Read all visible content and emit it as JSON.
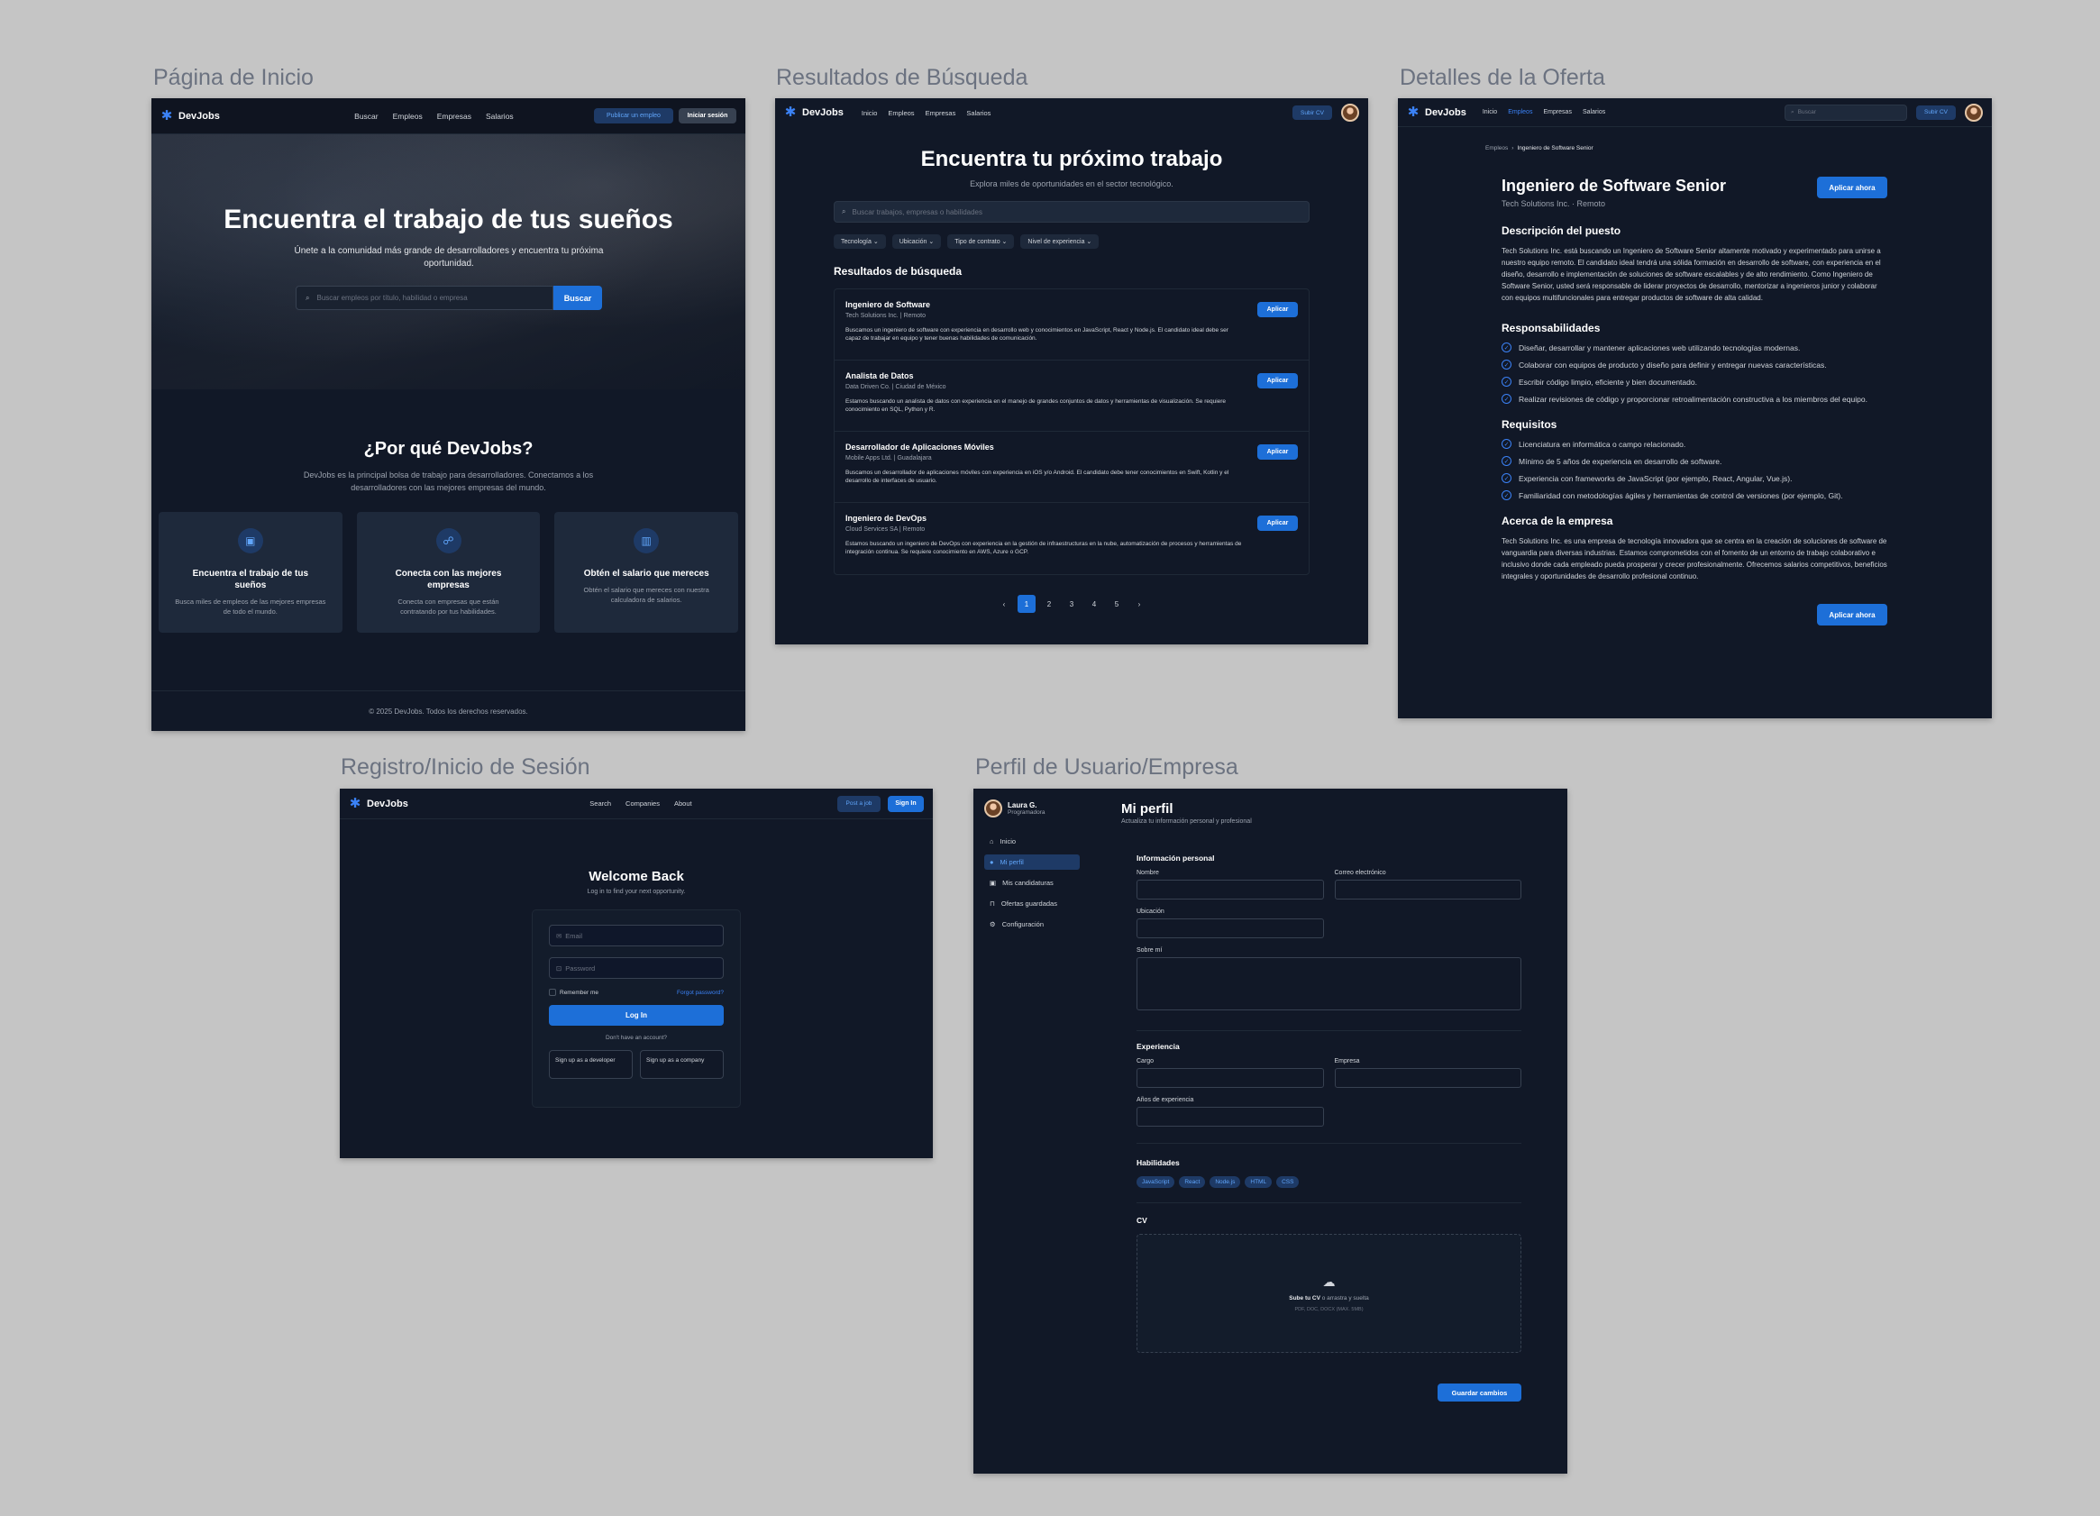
{
  "captions": {
    "home": "Página de Inicio",
    "search": "Resultados de Búsqueda",
    "detail": "Detalles de la Oferta",
    "login": "Registro/Inicio de Sesión",
    "profile": "Perfil de Usuario/Empresa"
  },
  "colors": {
    "background": "#111827",
    "accent": "#1d6fd8",
    "card": "#1e293b"
  },
  "home": {
    "brand": "DevJobs",
    "nav": [
      "Buscar",
      "Empleos",
      "Empresas",
      "Salarios"
    ],
    "post_job": "Publicar un empleo",
    "login": "Iniciar sesión",
    "hero_title": "Encuentra el trabajo de tus sueños",
    "hero_sub": "Únete a la comunidad más grande de desarrolladores y encuentra tu próxima oportunidad.",
    "search_placeholder": "Buscar empleos por título, habilidad o empresa",
    "search_btn": "Buscar",
    "why_title": "¿Por qué DevJobs?",
    "why_sub": "DevJobs es la principal bolsa de trabajo para desarrolladores. Conectamos a los desarrolladores con las mejores empresas del mundo.",
    "features": [
      {
        "icon": "briefcase-icon",
        "title": "Encuentra el trabajo de tus sueños",
        "text": "Busca miles de empleos de las mejores empresas de todo el mundo."
      },
      {
        "icon": "users-icon",
        "title": "Conecta con las mejores empresas",
        "text": "Conecta con empresas que están contratando por tus habilidades."
      },
      {
        "icon": "building-icon",
        "title": "Obtén el salario que mereces",
        "text": "Obtén el salario que mereces con nuestra calculadora de salarios."
      }
    ],
    "footer": "© 2025 DevJobs. Todos los derechos reservados."
  },
  "search": {
    "brand": "DevJobs",
    "nav": [
      "Inicio",
      "Empleos",
      "Empresas",
      "Salarios"
    ],
    "upload_cv": "Subir CV",
    "title": "Encuentra tu próximo trabajo",
    "subtitle": "Explora miles de oportunidades en el sector tecnológico.",
    "placeholder": "Buscar trabajos, empresas o habilidades",
    "filters": [
      "Tecnología",
      "Ubicación",
      "Tipo de contrato",
      "Nivel de experiencia"
    ],
    "results_title": "Resultados de búsqueda",
    "apply": "Aplicar",
    "jobs": [
      {
        "title": "Ingeniero de Software",
        "company": "Tech Solutions Inc. | Remoto",
        "desc": "Buscamos un ingeniero de software con experiencia en desarrollo web y conocimientos en JavaScript, React y Node.js. El candidato ideal debe ser capaz de trabajar en equipo y tener buenas habilidades de comunicación."
      },
      {
        "title": "Analista de Datos",
        "company": "Data Driven Co. | Ciudad de México",
        "desc": "Estamos buscando un analista de datos con experiencia en el manejo de grandes conjuntos de datos y herramientas de visualización. Se requiere conocimiento en SQL, Python y R."
      },
      {
        "title": "Desarrollador de Aplicaciones Móviles",
        "company": "Mobile Apps Ltd. | Guadalajara",
        "desc": "Buscamos un desarrollador de aplicaciones móviles con experiencia en iOS y/o Android. El candidato debe tener conocimientos en Swift, Kotlin y el desarrollo de interfaces de usuario."
      },
      {
        "title": "Ingeniero de DevOps",
        "company": "Cloud Services SA | Remoto",
        "desc": "Estamos buscando un ingeniero de DevOps con experiencia en la gestión de infraestructuras en la nube, automatización de procesos y herramientas de integración continua. Se requiere conocimiento en AWS, Azure o GCP."
      }
    ],
    "pages": [
      "1",
      "2",
      "3",
      "4",
      "5"
    ],
    "prev": "‹",
    "next": "›"
  },
  "detail": {
    "brand": "DevJobs",
    "nav": [
      "Inicio",
      "Empleos",
      "Empresas",
      "Salarios"
    ],
    "search_placeholder": "Buscar",
    "upload_cv": "Subir CV",
    "crumb_root": "Empleos",
    "crumb_sep": "›",
    "crumb_current": "Ingeniero de Software Senior",
    "title": "Ingeniero de Software Senior",
    "company": "Tech Solutions Inc. · Remoto",
    "apply": "Aplicar ahora",
    "desc_title": "Descripción del puesto",
    "desc": "Tech Solutions Inc. está buscando un Ingeniero de Software Senior altamente motivado y experimentado para unirse a nuestro equipo remoto. El candidato ideal tendrá una sólida formación en desarrollo de software, con experiencia en el diseño, desarrollo e implementación de soluciones de software escalables y de alto rendimiento. Como Ingeniero de Software Senior, usted será responsable de liderar proyectos de desarrollo, mentorizar a ingenieros junior y colaborar con equipos multifuncionales para entregar productos de software de alta calidad.",
    "resp_title": "Responsabilidades",
    "resp": [
      "Diseñar, desarrollar y mantener aplicaciones web utilizando tecnologías modernas.",
      "Colaborar con equipos de producto y diseño para definir y entregar nuevas características.",
      "Escribir código limpio, eficiente y bien documentado.",
      "Realizar revisiones de código y proporcionar retroalimentación constructiva a los miembros del equipo."
    ],
    "req_title": "Requisitos",
    "req": [
      "Licenciatura en informática o campo relacionado.",
      "Mínimo de 5 años de experiencia en desarrollo de software.",
      "Experiencia con frameworks de JavaScript (por ejemplo, React, Angular, Vue.js).",
      "Familiaridad con metodologías ágiles y herramientas de control de versiones (por ejemplo, Git)."
    ],
    "about_title": "Acerca de la empresa",
    "about": "Tech Solutions Inc. es una empresa de tecnología innovadora que se centra en la creación de soluciones de software de vanguardia para diversas industrias. Estamos comprometidos con el fomento de un entorno de trabajo colaborativo e inclusivo donde cada empleado pueda prosperar y crecer profesionalmente. Ofrecemos salarios competitivos, beneficios integrales y oportunidades de desarrollo profesional continuo."
  },
  "login": {
    "brand": "DevJobs",
    "nav": [
      "Search",
      "Companies",
      "About"
    ],
    "post_job": "Post a job",
    "sign_in": "Sign In",
    "title": "Welcome Back",
    "subtitle": "Log in to find your next opportunity.",
    "email": "Email",
    "password": "Password",
    "remember": "Remember me",
    "forgot": "Forgot password?",
    "login_btn": "Log In",
    "no_account": "Don't have an account?",
    "signup_dev": "Sign up as a developer",
    "signup_company": "Sign up as a company"
  },
  "profile": {
    "user_name": "Laura G.",
    "user_role": "Programadora",
    "menu": [
      "Inicio",
      "Mi perfil",
      "Mis candidaturas",
      "Ofertas guardadas",
      "Configuración"
    ],
    "menu_icons": [
      "home-icon",
      "user-icon",
      "briefcase-icon",
      "bookmark-icon",
      "gear-icon"
    ],
    "title": "Mi perfil",
    "subtitle": "Actualiza tu información personal y profesional",
    "personal_title": "Información personal",
    "name_label": "Nombre",
    "email_label": "Correo electrónico",
    "location_label": "Ubicación",
    "about_label": "Sobre mí",
    "exp_title": "Experiencia",
    "position_label": "Cargo",
    "company_label": "Empresa",
    "years_label": "Años de experiencia",
    "skills_title": "Habilidades",
    "skills": [
      "JavaScript",
      "React",
      "Node.js",
      "HTML",
      "CSS"
    ],
    "cv_title": "CV",
    "cv_upload_bold": "Sube tu CV",
    "cv_upload_rest": " o arrastra y suelta",
    "cv_formats": "PDF, DOC, DOCX (MAX. 5MB)",
    "save": "Guardar cambios"
  }
}
